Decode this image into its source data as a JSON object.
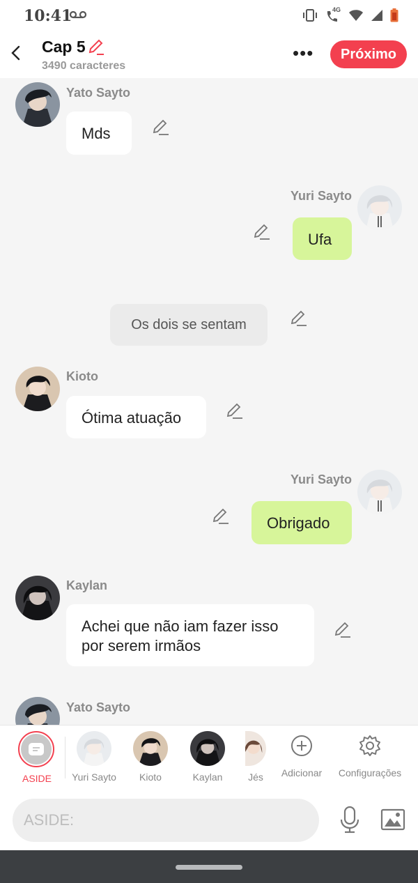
{
  "status_bar": {
    "time": "10:41",
    "network": "4G",
    "icons": [
      "voicemail-icon",
      "vibrate-icon",
      "call-4g-icon",
      "wifi-icon",
      "signal-icon",
      "battery-icon"
    ]
  },
  "header": {
    "title": "Cap 5",
    "subtitle": "3490 caracteres",
    "next_label": "Próximo",
    "accent_color": "#f3404f"
  },
  "messages": [
    {
      "type": "left",
      "name": "Yato Sayto",
      "text": "Mds"
    },
    {
      "type": "right",
      "name": "Yuri Sayto",
      "text": "Ufa"
    },
    {
      "type": "aside",
      "text": "Os dois se sentam"
    },
    {
      "type": "left",
      "name": "Kioto",
      "text": "Ótima atuação"
    },
    {
      "type": "right",
      "name": "Yuri Sayto",
      "text": "Obrigado"
    },
    {
      "type": "left",
      "name": "Kaylan",
      "text": "Achei que não iam fazer isso por serem irmãos"
    },
    {
      "type": "left",
      "name": "Yato Sayto",
      "text": ""
    }
  ],
  "character_bar": {
    "aside_label": "ASIDE",
    "characters": [
      "Yuri Sayto",
      "Kioto",
      "Kaylan",
      "Jés"
    ],
    "add_label": "Adicionar",
    "settings_label": "Configurações"
  },
  "input": {
    "placeholder": "ASIDE:"
  }
}
